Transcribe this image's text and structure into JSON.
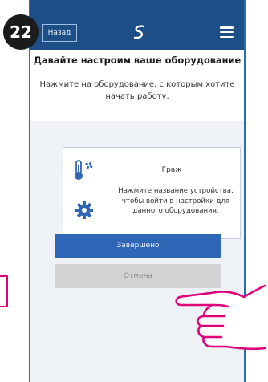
{
  "step": {
    "number": "22"
  },
  "header": {
    "back_label": "Назад",
    "logo_icon": "s-logo-icon",
    "menu_icon": "hamburger-menu-icon"
  },
  "page": {
    "title": "Давайте настроим ваше оборудование",
    "intro": "Нажмите на оборудование, с которым хотите начать работу."
  },
  "equipment": {
    "name": "Граж",
    "hint": "Нажмите название устройства, чтобы войти в настройки для данного оборудования.",
    "icons": [
      "thermometer-fan-icon",
      "gear-icon"
    ]
  },
  "actions": {
    "done_label": "Завершено",
    "cancel_label": "Отмена"
  },
  "colors": {
    "header": "#1d4f86",
    "primary_button": "#2f66b6",
    "secondary_button": "#d3d3d3",
    "accent": "#e0007a"
  }
}
